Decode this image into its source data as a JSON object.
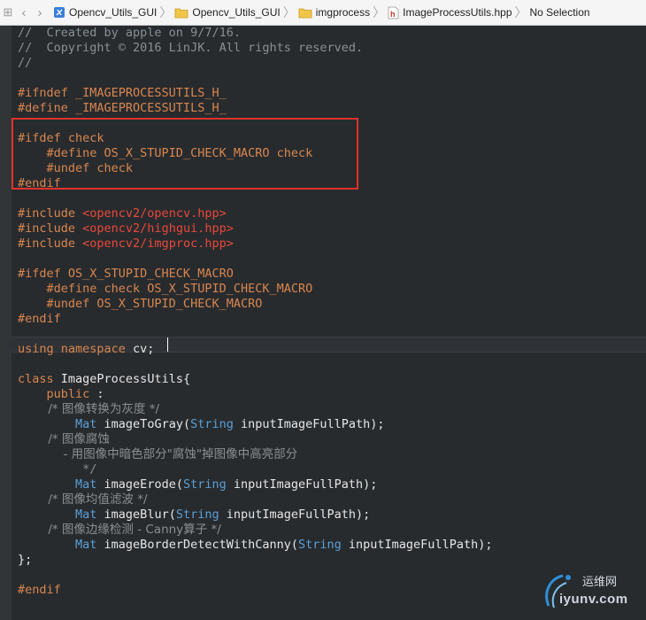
{
  "jumpbar": {
    "crumbs": [
      {
        "label": "Opencv_Utils_GUI",
        "icon": "xcode-project-icon"
      },
      {
        "label": "Opencv_Utils_GUI",
        "icon": "folder-icon"
      },
      {
        "label": "imgprocess",
        "icon": "folder-icon"
      },
      {
        "label": "ImageProcessUtils.hpp",
        "icon": "header-file-icon"
      },
      {
        "label": "No Selection",
        "icon": ""
      }
    ]
  },
  "code": {
    "lines": [
      [
        {
          "t": "//  Created by apple on 9/7/16.",
          "c": "comment"
        }
      ],
      [
        {
          "t": "//  Copyright © 2016 LinJK. All rights reserved.",
          "c": "comment"
        }
      ],
      [
        {
          "t": "//",
          "c": "comment"
        }
      ],
      [],
      [
        {
          "t": "#ifndef _IMAGEPROCESSUTILS_H_",
          "c": "pre"
        }
      ],
      [
        {
          "t": "#define _IMAGEPROCESSUTILS_H_",
          "c": "pre"
        }
      ],
      [],
      [
        {
          "t": "#ifdef check",
          "c": "pre"
        }
      ],
      [
        {
          "t": "    #define OS_X_STUPID_CHECK_MACRO check",
          "c": "pre"
        }
      ],
      [
        {
          "t": "    #undef check",
          "c": "pre"
        }
      ],
      [
        {
          "t": "#endif",
          "c": "pre"
        }
      ],
      [],
      [
        {
          "t": "#include ",
          "c": "pre"
        },
        {
          "t": "<opencv2/opencv.hpp>",
          "c": "str"
        }
      ],
      [
        {
          "t": "#include ",
          "c": "pre"
        },
        {
          "t": "<opencv2/highgui.hpp>",
          "c": "str"
        }
      ],
      [
        {
          "t": "#include ",
          "c": "pre"
        },
        {
          "t": "<opencv2/imgproc.hpp>",
          "c": "str"
        }
      ],
      [],
      [
        {
          "t": "#ifdef OS_X_STUPID_CHECK_MACRO",
          "c": "pre"
        }
      ],
      [
        {
          "t": "    #define check OS_X_STUPID_CHECK_MACRO",
          "c": "pre"
        }
      ],
      [
        {
          "t": "    #undef OS_X_STUPID_CHECK_MACRO",
          "c": "pre"
        }
      ],
      [
        {
          "t": "#endif",
          "c": "pre"
        }
      ],
      [],
      [
        {
          "t": "using namespace ",
          "c": "kw"
        },
        {
          "t": "cv;",
          "c": "ident"
        }
      ],
      [],
      [
        {
          "t": "class ",
          "c": "kw"
        },
        {
          "t": "ImageProcessUtils{",
          "c": "ident"
        }
      ],
      [
        {
          "t": "    public ",
          "c": "kw"
        },
        {
          "t": ":",
          "c": "ident"
        }
      ],
      [
        {
          "t": "        /* 图像转换为灰度 */",
          "c": "comment"
        }
      ],
      [
        {
          "t": "        ",
          "c": "ident"
        },
        {
          "t": "Mat ",
          "c": "type"
        },
        {
          "t": "imageToGray(",
          "c": "ident"
        },
        {
          "t": "String ",
          "c": "type"
        },
        {
          "t": "inputImageFullPath);",
          "c": "ident"
        }
      ],
      [
        {
          "t": "        /* 图像腐蚀",
          "c": "comment"
        }
      ],
      [
        {
          "t": "            - 用图像中暗色部分\"腐蚀\"掉图像中高亮部分",
          "c": "comment"
        }
      ],
      [
        {
          "t": "         */",
          "c": "comment"
        }
      ],
      [
        {
          "t": "        ",
          "c": "ident"
        },
        {
          "t": "Mat ",
          "c": "type"
        },
        {
          "t": "imageErode(",
          "c": "ident"
        },
        {
          "t": "String ",
          "c": "type"
        },
        {
          "t": "inputImageFullPath);",
          "c": "ident"
        }
      ],
      [
        {
          "t": "        /* 图像均值滤波 */",
          "c": "comment"
        }
      ],
      [
        {
          "t": "        ",
          "c": "ident"
        },
        {
          "t": "Mat ",
          "c": "type"
        },
        {
          "t": "imageBlur(",
          "c": "ident"
        },
        {
          "t": "String ",
          "c": "type"
        },
        {
          "t": "inputImageFullPath);",
          "c": "ident"
        }
      ],
      [
        {
          "t": "        /* 图像边缘检测 - Canny算子 */",
          "c": "comment"
        }
      ],
      [
        {
          "t": "        ",
          "c": "ident"
        },
        {
          "t": "Mat ",
          "c": "type"
        },
        {
          "t": "imageBorderDetectWithCanny(",
          "c": "ident"
        },
        {
          "t": "String ",
          "c": "type"
        },
        {
          "t": "inputImageFullPath);",
          "c": "ident"
        }
      ],
      [
        {
          "t": "};",
          "c": "ident"
        }
      ],
      [],
      [
        {
          "t": "#endif",
          "c": "pre"
        }
      ]
    ]
  },
  "watermark": {
    "line1": "运维网",
    "line2": "iyunv.com"
  },
  "colors": {
    "background": "#282b2e",
    "preprocessor": "#d9864f",
    "type": "#5a9fd6",
    "string": "#e8483b",
    "comment": "#8a8f92",
    "highlight": "#e0322b"
  }
}
